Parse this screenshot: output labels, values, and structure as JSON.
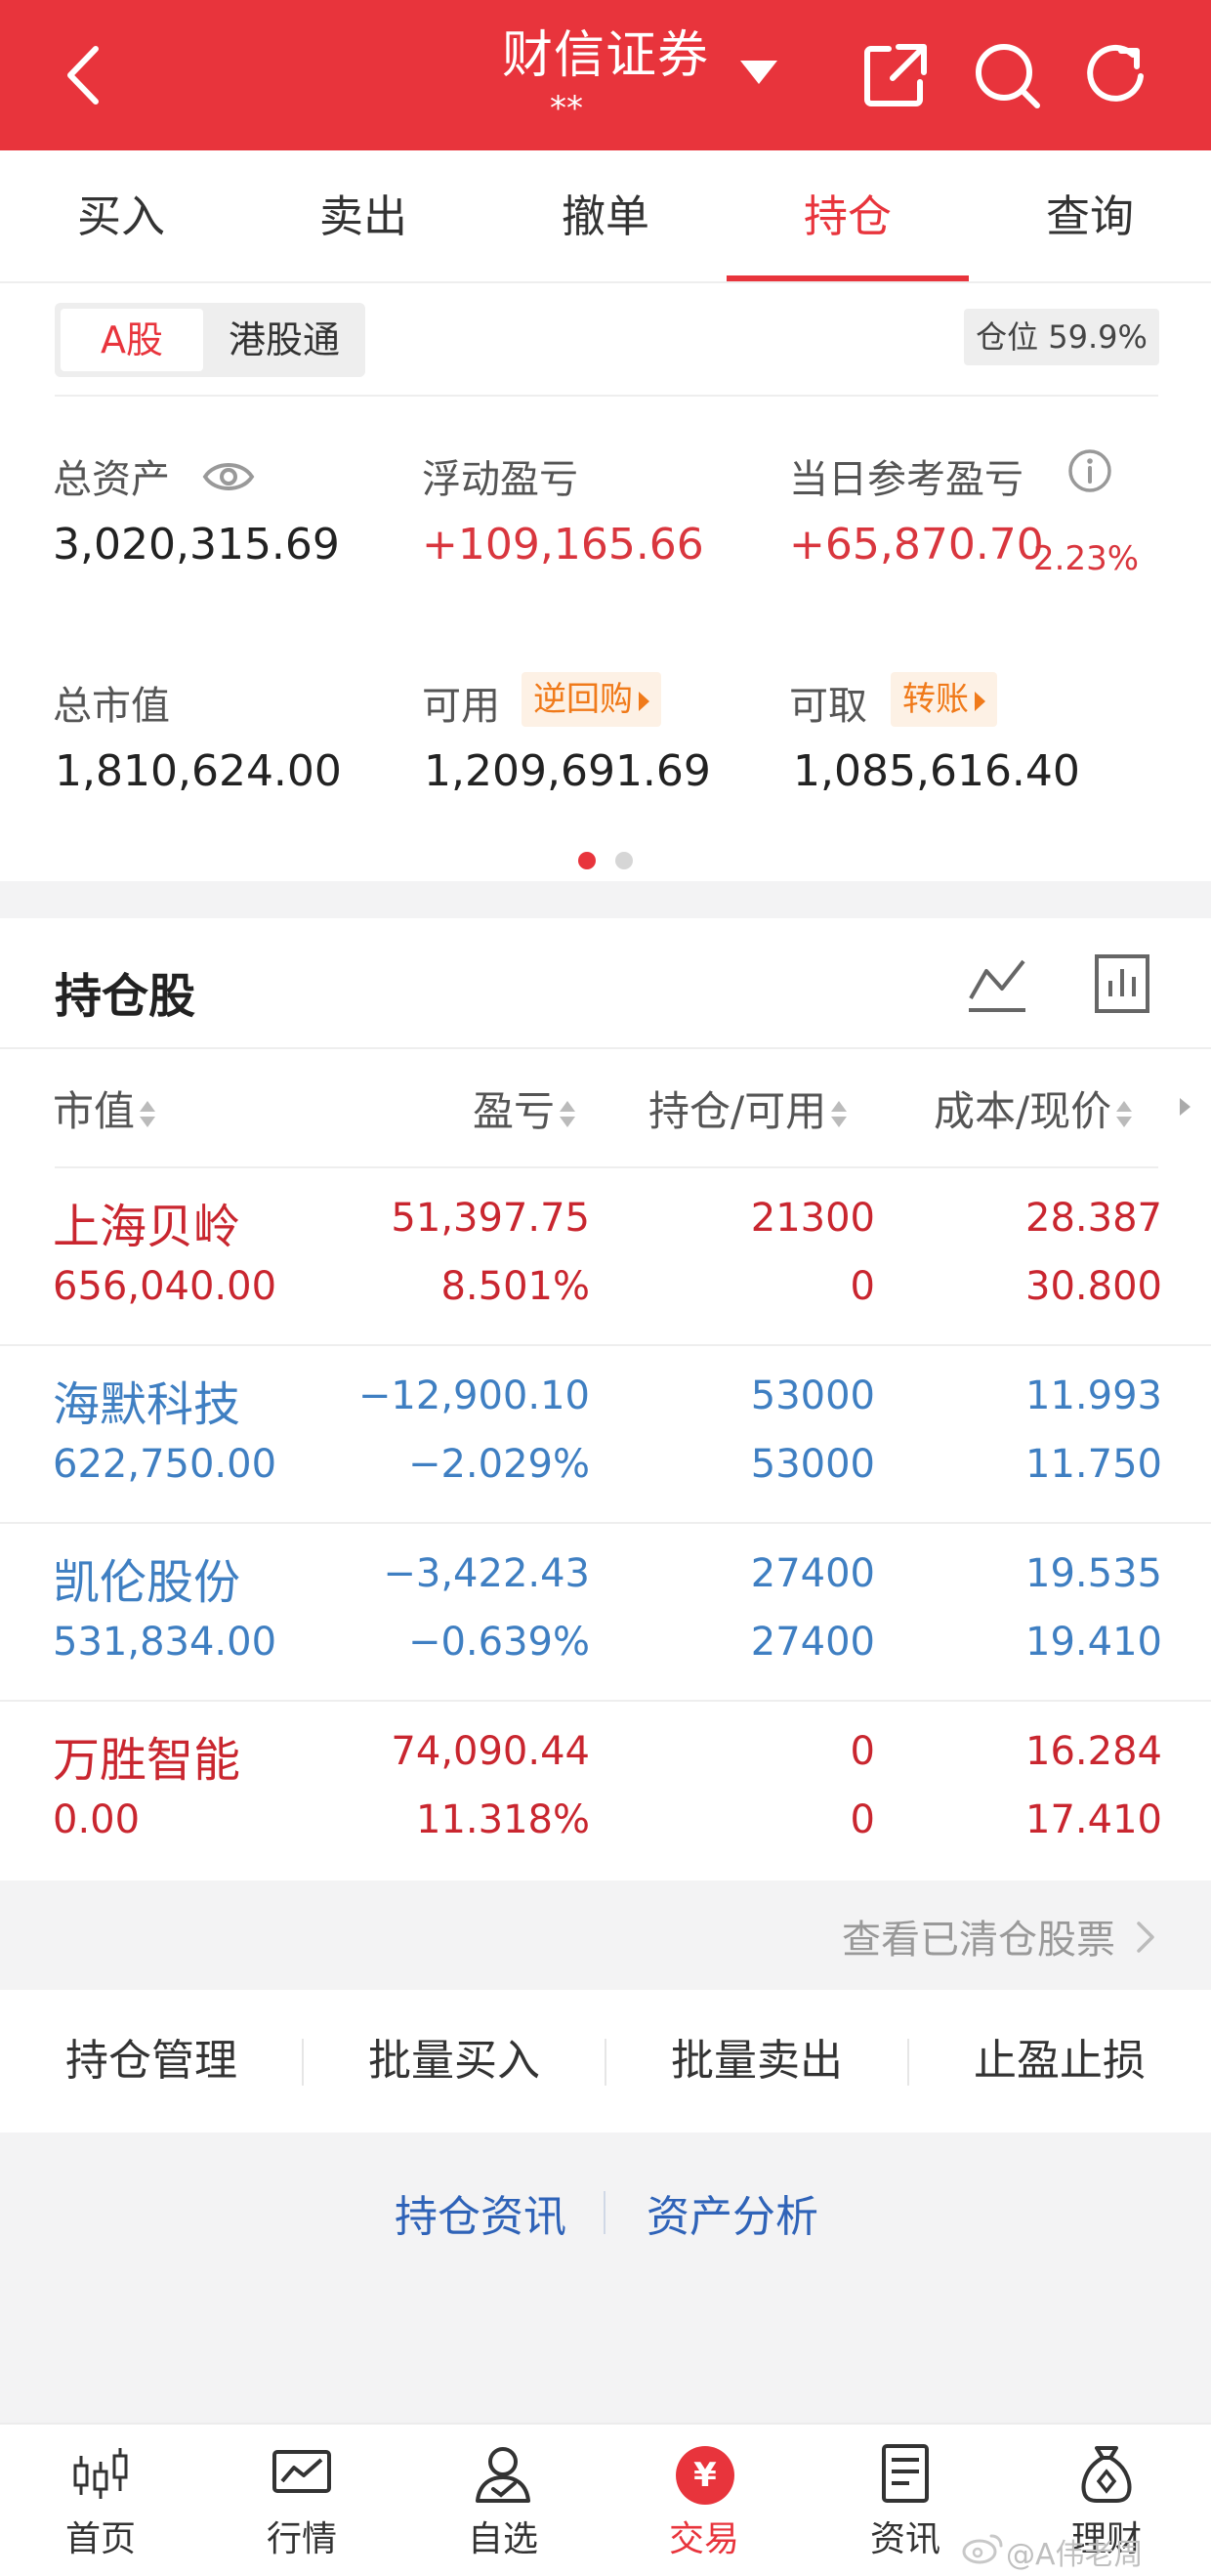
{
  "header": {
    "title": "财信证券",
    "subtitle": "**"
  },
  "tabs": [
    {
      "label": "买入"
    },
    {
      "label": "卖出"
    },
    {
      "label": "撤单"
    },
    {
      "label": "持仓",
      "active": true
    },
    {
      "label": "查询"
    }
  ],
  "account": {
    "segments": [
      "A股",
      "港股通"
    ],
    "position_label": "仓位 59.9%",
    "total_assets_label": "总资产",
    "total_assets": "3,020,315.69",
    "floating_pl_label": "浮动盈亏",
    "floating_pl": "+109,165.66",
    "daily_pl_label": "当日参考盈亏",
    "daily_pl": "+65,870.70",
    "daily_pl_pct": "2.23%",
    "market_value_label": "总市值",
    "market_value": "1,810,624.00",
    "available_label": "可用",
    "reverse_repo_label": "逆回购",
    "available": "1,209,691.69",
    "withdrawable_label": "可取",
    "transfer_label": "转账",
    "withdrawable": "1,085,616.40"
  },
  "holdings": {
    "title": "持仓股",
    "columns": [
      "市值",
      "盈亏",
      "持仓/可用",
      "成本/现价"
    ],
    "rows": [
      {
        "name": "上海贝岭",
        "market_value": "656,040.00",
        "pl": "51,397.75",
        "pl_pct": "8.501%",
        "qty": "21300",
        "avail": "0",
        "cost": "28.387",
        "price": "30.800",
        "trend": "up"
      },
      {
        "name": "海默科技",
        "market_value": "622,750.00",
        "pl": "−12,900.10",
        "pl_pct": "−2.029%",
        "qty": "53000",
        "avail": "53000",
        "cost": "11.993",
        "price": "11.750",
        "trend": "down"
      },
      {
        "name": "凯伦股份",
        "market_value": "531,834.00",
        "pl": "−3,422.43",
        "pl_pct": "−0.639%",
        "qty": "27400",
        "avail": "27400",
        "cost": "19.535",
        "price": "19.410",
        "trend": "down"
      },
      {
        "name": "万胜智能",
        "market_value": "0.00",
        "pl": "74,090.44",
        "pl_pct": "11.318%",
        "qty": "0",
        "avail": "0",
        "cost": "16.284",
        "price": "17.410",
        "trend": "up"
      }
    ],
    "cleared_link": "查看已清仓股票"
  },
  "actions": [
    "持仓管理",
    "批量买入",
    "批量卖出",
    "止盈止损"
  ],
  "links": [
    "持仓资讯",
    "资产分析"
  ],
  "nav": [
    {
      "label": "首页",
      "icon": "candlestick-icon"
    },
    {
      "label": "行情",
      "icon": "market-chart-icon"
    },
    {
      "label": "自选",
      "icon": "watchlist-person-icon"
    },
    {
      "label": "交易",
      "icon": "yuan-icon",
      "active": true
    },
    {
      "label": "资讯",
      "icon": "news-document-icon"
    },
    {
      "label": "理财",
      "icon": "money-bag-icon"
    }
  ],
  "yuan_symbol": "¥",
  "watermark": "@A伟老周",
  "colors": {
    "brand_red": "#e8343c",
    "up": "#c9262f",
    "down": "#3f7fc2",
    "link": "#2f63b8",
    "chip": "#f07a1a"
  }
}
